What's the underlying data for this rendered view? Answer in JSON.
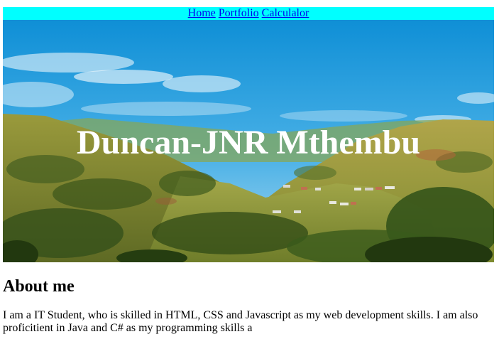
{
  "nav": {
    "links": [
      {
        "label": "Home"
      },
      {
        "label": "Portfolio"
      },
      {
        "label": "Calculalor"
      }
    ]
  },
  "hero": {
    "title": "Duncan-JNR Mthembu",
    "image": "landscape-photo"
  },
  "about": {
    "heading": "About me",
    "text": "I am a IT Student, who is skilled in HTML, CSS and Javascript as my web development skills. I am also proficitient in Java and C# as my programming skills a"
  },
  "colors": {
    "nav_background": "#00ffff",
    "link": "#0000ee",
    "title": "#ffffff"
  }
}
